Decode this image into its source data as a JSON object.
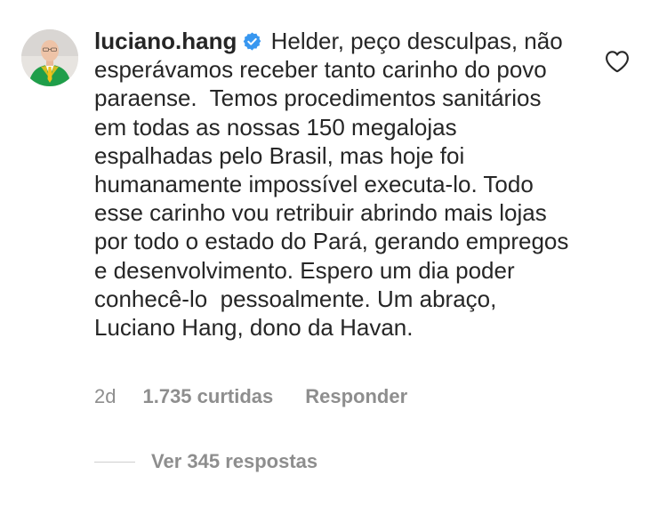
{
  "comment": {
    "username": "luciano.hang",
    "text": "Helder, peço desculpas, não esperávamos receber tanto carinho do povo paraense.  Temos procedimentos sanitários em todas as nossas 150 megalojas espalhadas pelo Brasil, mas hoje foi humanamente impossível executa-lo. Todo esse carinho vou retribuir abrindo mais lojas por todo o estado do Pará, gerando empregos e desenvolvimento. Espero um dia poder conhecê-lo  pessoalmente. Um abraço, Luciano Hang, dono da Havan.",
    "timestamp": "2d",
    "likes": "1.735 curtidas",
    "reply_label": "Responder",
    "view_replies_label": "Ver 345 respostas"
  },
  "colors": {
    "text": "#262626",
    "secondary": "#8e8e8e",
    "verified": "#3897f0",
    "avatar_suit": "#1f9e4a"
  },
  "icons": {
    "verified": "verified-badge-icon",
    "like": "heart-outline-icon"
  }
}
